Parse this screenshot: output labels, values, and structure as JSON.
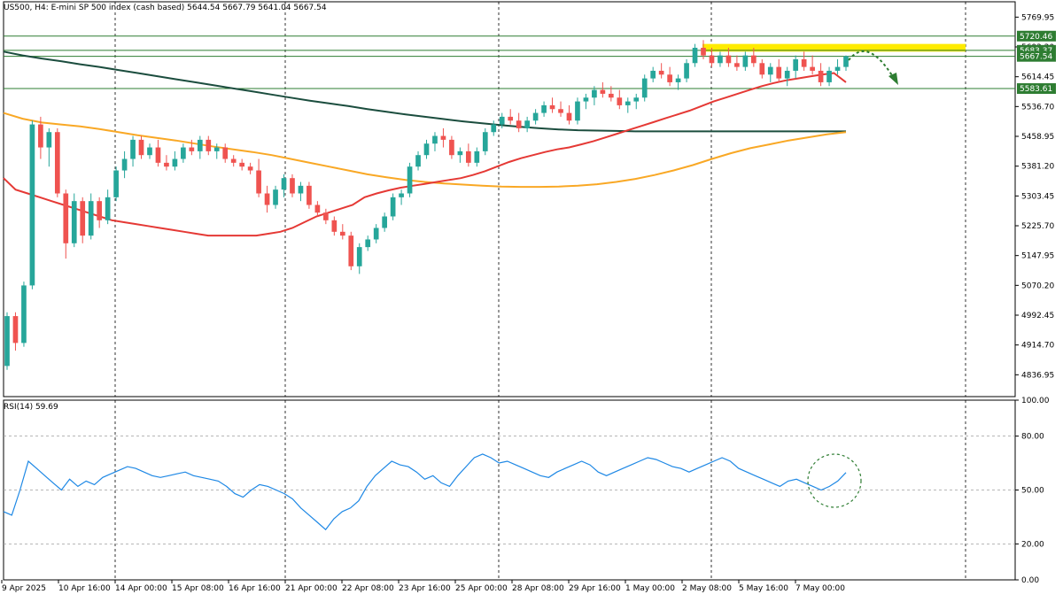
{
  "header": {
    "symbol_line": "US500, H4:  E-mini SP 500 index (cash based)  5644.54 5667.79 5641.04 5667.54"
  },
  "rsi_panel": {
    "label": "RSI(14) 59.69",
    "levels": [
      "100.00",
      "80.00",
      "50.00",
      "20.00",
      "0.00"
    ]
  },
  "colors": {
    "bull": "#26a69a",
    "bear": "#ef5350",
    "ma_fast": "#e53935",
    "ma_mid": "#f9a825",
    "ma_slow": "#1b4d3e",
    "rsi": "#1e88e5",
    "zone": "#ffeb00",
    "level_line": "#2e7d32",
    "arrow": "#2e7d32"
  },
  "chart_data": {
    "type": "candlestick",
    "price_axis_ticks": [
      "5769.95",
      "5692.20",
      "5614.45",
      "5536.70",
      "5458.95",
      "5381.20",
      "5303.45",
      "5225.70",
      "5147.95",
      "5070.20",
      "4992.45",
      "4914.70",
      "4836.95"
    ],
    "ylim": [
      4780,
      5810
    ],
    "x_labels": [
      "9 Apr 2025",
      "10 Apr 16:00",
      "14 Apr 00:00",
      "15 Apr 08:00",
      "16 Apr 16:00",
      "21 Apr 00:00",
      "22 Apr 08:00",
      "23 Apr 16:00",
      "25 Apr 00:00",
      "28 Apr 08:00",
      "29 Apr 16:00",
      "1 May 00:00",
      "2 May 08:00",
      "5 May 16:00",
      "7 May 00:00"
    ],
    "horizontal_levels": [
      {
        "value": 5720.46,
        "label": "5720.46"
      },
      {
        "value": 5683.37,
        "label": "5683.37"
      },
      {
        "value": 5667.54,
        "label": "5667.54"
      },
      {
        "value": 5583.61,
        "label": "5583.61"
      }
    ],
    "resistance_zone": [
      5680,
      5700
    ],
    "candles": [
      [
        4860,
        5000,
        4850,
        4990
      ],
      [
        4990,
        5000,
        4900,
        4920
      ],
      [
        4920,
        5080,
        4910,
        5070
      ],
      [
        5070,
        5500,
        5060,
        5490
      ],
      [
        5490,
        5510,
        5400,
        5430
      ],
      [
        5430,
        5480,
        5380,
        5470
      ],
      [
        5470,
        5480,
        5300,
        5310
      ],
      [
        5310,
        5320,
        5140,
        5180
      ],
      [
        5180,
        5310,
        5170,
        5290
      ],
      [
        5290,
        5300,
        5180,
        5200
      ],
      [
        5200,
        5310,
        5190,
        5290
      ],
      [
        5290,
        5300,
        5220,
        5240
      ],
      [
        5240,
        5320,
        5230,
        5300
      ],
      [
        5300,
        5380,
        5290,
        5370
      ],
      [
        5370,
        5420,
        5350,
        5400
      ],
      [
        5400,
        5460,
        5380,
        5450
      ],
      [
        5450,
        5460,
        5400,
        5410
      ],
      [
        5410,
        5440,
        5400,
        5430
      ],
      [
        5430,
        5450,
        5380,
        5390
      ],
      [
        5390,
        5410,
        5370,
        5380
      ],
      [
        5380,
        5420,
        5370,
        5400
      ],
      [
        5400,
        5440,
        5390,
        5430
      ],
      [
        5430,
        5450,
        5410,
        5420
      ],
      [
        5420,
        5460,
        5400,
        5450
      ],
      [
        5450,
        5460,
        5410,
        5420
      ],
      [
        5420,
        5440,
        5400,
        5430
      ],
      [
        5430,
        5440,
        5390,
        5400
      ],
      [
        5400,
        5410,
        5380,
        5390
      ],
      [
        5390,
        5400,
        5370,
        5380
      ],
      [
        5380,
        5390,
        5360,
        5370
      ],
      [
        5370,
        5400,
        5300,
        5310
      ],
      [
        5310,
        5330,
        5260,
        5280
      ],
      [
        5280,
        5330,
        5270,
        5320
      ],
      [
        5320,
        5360,
        5300,
        5350
      ],
      [
        5350,
        5360,
        5300,
        5310
      ],
      [
        5310,
        5340,
        5290,
        5330
      ],
      [
        5330,
        5340,
        5270,
        5280
      ],
      [
        5280,
        5290,
        5250,
        5260
      ],
      [
        5260,
        5270,
        5230,
        5240
      ],
      [
        5240,
        5250,
        5200,
        5210
      ],
      [
        5210,
        5230,
        5190,
        5200
      ],
      [
        5200,
        5210,
        5110,
        5120
      ],
      [
        5120,
        5180,
        5100,
        5170
      ],
      [
        5170,
        5200,
        5160,
        5190
      ],
      [
        5190,
        5230,
        5180,
        5220
      ],
      [
        5220,
        5260,
        5210,
        5250
      ],
      [
        5250,
        5310,
        5240,
        5300
      ],
      [
        5300,
        5320,
        5280,
        5310
      ],
      [
        5310,
        5390,
        5300,
        5380
      ],
      [
        5380,
        5420,
        5370,
        5410
      ],
      [
        5410,
        5450,
        5400,
        5440
      ],
      [
        5440,
        5470,
        5420,
        5460
      ],
      [
        5460,
        5480,
        5430,
        5450
      ],
      [
        5450,
        5460,
        5400,
        5410
      ],
      [
        5410,
        5430,
        5390,
        5420
      ],
      [
        5420,
        5440,
        5380,
        5390
      ],
      [
        5390,
        5430,
        5380,
        5420
      ],
      [
        5420,
        5480,
        5410,
        5470
      ],
      [
        5470,
        5500,
        5460,
        5490
      ],
      [
        5490,
        5520,
        5480,
        5510
      ],
      [
        5510,
        5530,
        5490,
        5500
      ],
      [
        5500,
        5520,
        5470,
        5480
      ],
      [
        5480,
        5510,
        5470,
        5500
      ],
      [
        5500,
        5530,
        5490,
        5520
      ],
      [
        5520,
        5550,
        5510,
        5540
      ],
      [
        5540,
        5560,
        5520,
        5530
      ],
      [
        5530,
        5550,
        5510,
        5520
      ],
      [
        5520,
        5540,
        5490,
        5500
      ],
      [
        5500,
        5560,
        5490,
        5550
      ],
      [
        5550,
        5570,
        5530,
        5560
      ],
      [
        5560,
        5590,
        5540,
        5580
      ],
      [
        5580,
        5600,
        5560,
        5570
      ],
      [
        5570,
        5590,
        5550,
        5560
      ],
      [
        5560,
        5580,
        5530,
        5540
      ],
      [
        5540,
        5560,
        5520,
        5550
      ],
      [
        5550,
        5570,
        5530,
        5560
      ],
      [
        5560,
        5620,
        5550,
        5610
      ],
      [
        5610,
        5640,
        5600,
        5630
      ],
      [
        5630,
        5650,
        5610,
        5620
      ],
      [
        5620,
        5640,
        5590,
        5600
      ],
      [
        5600,
        5620,
        5580,
        5610
      ],
      [
        5610,
        5660,
        5600,
        5650
      ],
      [
        5650,
        5700,
        5640,
        5690
      ],
      [
        5690,
        5710,
        5660,
        5670
      ],
      [
        5670,
        5690,
        5640,
        5650
      ],
      [
        5650,
        5680,
        5640,
        5670
      ],
      [
        5670,
        5690,
        5640,
        5650
      ],
      [
        5650,
        5670,
        5630,
        5640
      ],
      [
        5640,
        5680,
        5630,
        5670
      ],
      [
        5670,
        5690,
        5640,
        5650
      ],
      [
        5650,
        5660,
        5610,
        5620
      ],
      [
        5620,
        5650,
        5600,
        5640
      ],
      [
        5640,
        5660,
        5600,
        5610
      ],
      [
        5610,
        5640,
        5590,
        5630
      ],
      [
        5630,
        5670,
        5610,
        5660
      ],
      [
        5660,
        5680,
        5630,
        5640
      ],
      [
        5640,
        5670,
        5620,
        5630
      ],
      [
        5630,
        5650,
        5590,
        5600
      ],
      [
        5600,
        5640,
        5590,
        5630
      ],
      [
        5630,
        5660,
        5620,
        5640
      ],
      [
        5640,
        5670,
        5630,
        5668
      ]
    ],
    "rsi_values": [
      38,
      36,
      50,
      66,
      62,
      58,
      54,
      50,
      56,
      52,
      55,
      53,
      57,
      59,
      61,
      63,
      62,
      60,
      58,
      57,
      58,
      59,
      60,
      58,
      57,
      56,
      55,
      52,
      48,
      46,
      50,
      53,
      52,
      50,
      48,
      45,
      40,
      36,
      32,
      28,
      34,
      38,
      40,
      44,
      52,
      58,
      62,
      66,
      64,
      63,
      60,
      56,
      58,
      54,
      52,
      58,
      63,
      68,
      70,
      68,
      65,
      66,
      64,
      62,
      60,
      58,
      57,
      60,
      62,
      64,
      66,
      64,
      60,
      58,
      60,
      62,
      64,
      66,
      68,
      67,
      65,
      63,
      62,
      60,
      62,
      64,
      66,
      68,
      66,
      62,
      60,
      58,
      56,
      54,
      52,
      55,
      56,
      54,
      52,
      50,
      52,
      55,
      59.69
    ],
    "ma_fast": [
      5350,
      5320,
      5310,
      5300,
      5290,
      5280,
      5270,
      5260,
      5250,
      5240,
      5235,
      5230,
      5225,
      5220,
      5215,
      5210,
      5205,
      5200,
      5200,
      5200,
      5200,
      5200,
      5205,
      5210,
      5220,
      5235,
      5250,
      5260,
      5270,
      5280,
      5300,
      5310,
      5318,
      5325,
      5330,
      5335,
      5340,
      5345,
      5350,
      5358,
      5368,
      5380,
      5392,
      5402,
      5410,
      5418,
      5425,
      5430,
      5438,
      5446,
      5456,
      5466,
      5476,
      5486,
      5496,
      5506,
      5516,
      5526,
      5538,
      5550,
      5560,
      5570,
      5580,
      5590,
      5598,
      5605,
      5610,
      5615,
      5620,
      5624,
      5600
    ],
    "ma_mid": [
      5520,
      5505,
      5495,
      5490,
      5485,
      5478,
      5470,
      5462,
      5455,
      5448,
      5440,
      5432,
      5425,
      5418,
      5410,
      5400,
      5390,
      5380,
      5370,
      5360,
      5352,
      5345,
      5340,
      5336,
      5333,
      5330,
      5328,
      5327,
      5327,
      5328,
      5330,
      5334,
      5340,
      5348,
      5358,
      5370,
      5384,
      5400,
      5415,
      5428,
      5438,
      5448,
      5456,
      5464,
      5470
    ],
    "ma_slow": [
      5680,
      5670,
      5662,
      5655,
      5647,
      5640,
      5632,
      5624,
      5616,
      5608,
      5600,
      5592,
      5584,
      5576,
      5568,
      5560,
      5552,
      5545,
      5538,
      5530,
      5523,
      5516,
      5510,
      5504,
      5498,
      5493,
      5488,
      5484,
      5480,
      5477,
      5475,
      5474,
      5473,
      5472,
      5472,
      5472,
      5472,
      5472,
      5472,
      5472,
      5472,
      5472,
      5472,
      5472,
      5472
    ]
  }
}
